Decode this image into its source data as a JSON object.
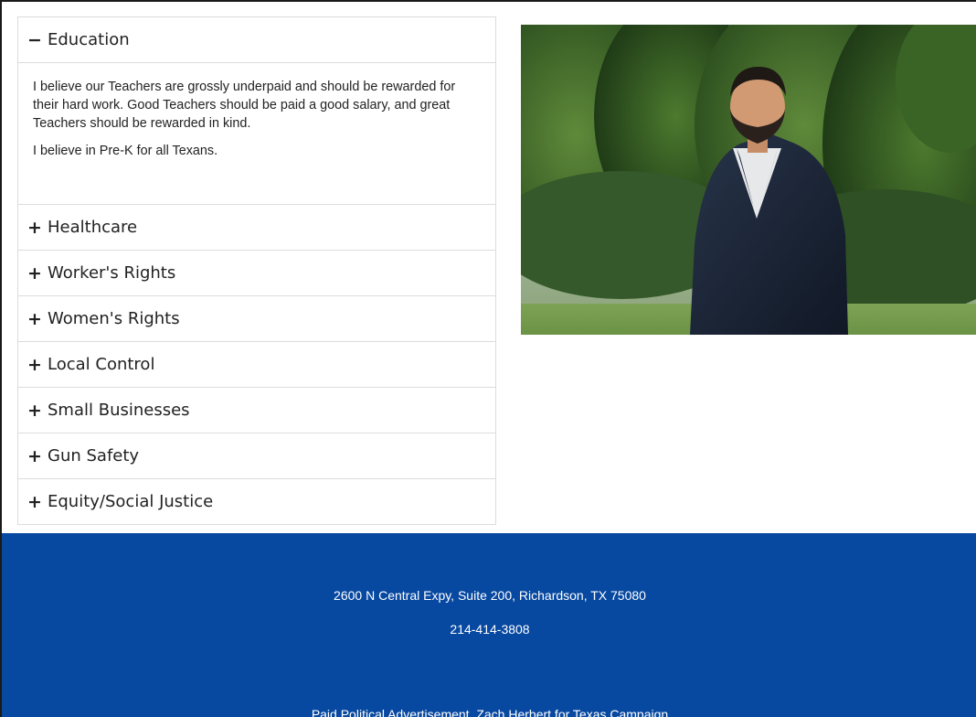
{
  "accordion": {
    "items": [
      {
        "sign": "−",
        "title": "Education",
        "expanded": true,
        "paragraphs": [
          "I believe our Teachers are grossly underpaid and should be rewarded for their hard work.  Good Teachers should be paid a good salary, and great Teachers should be rewarded in kind.",
          "I believe in Pre-K for all Texans."
        ]
      },
      {
        "sign": "+",
        "title": "Healthcare",
        "expanded": false
      },
      {
        "sign": "+",
        "title": "Worker's Rights",
        "expanded": false
      },
      {
        "sign": "+",
        "title": "Women's Rights",
        "expanded": false
      },
      {
        "sign": "+",
        "title": "Local Control",
        "expanded": false
      },
      {
        "sign": "+",
        "title": "Small Businesses",
        "expanded": false
      },
      {
        "sign": "+",
        "title": "Gun Safety",
        "expanded": false
      },
      {
        "sign": "+",
        "title": "Equity/Social Justice",
        "expanded": false
      }
    ]
  },
  "footer": {
    "address": "2600 N Central Expy, Suite 200, Richardson, TX 75080",
    "phone": "214-414-3808",
    "disclaimer": "Paid Political Advertisement, Zach Herbert for Texas Campaign"
  },
  "colors": {
    "footer_bg": "#0748a0",
    "border": "#dcdcdc",
    "text": "#222222"
  }
}
